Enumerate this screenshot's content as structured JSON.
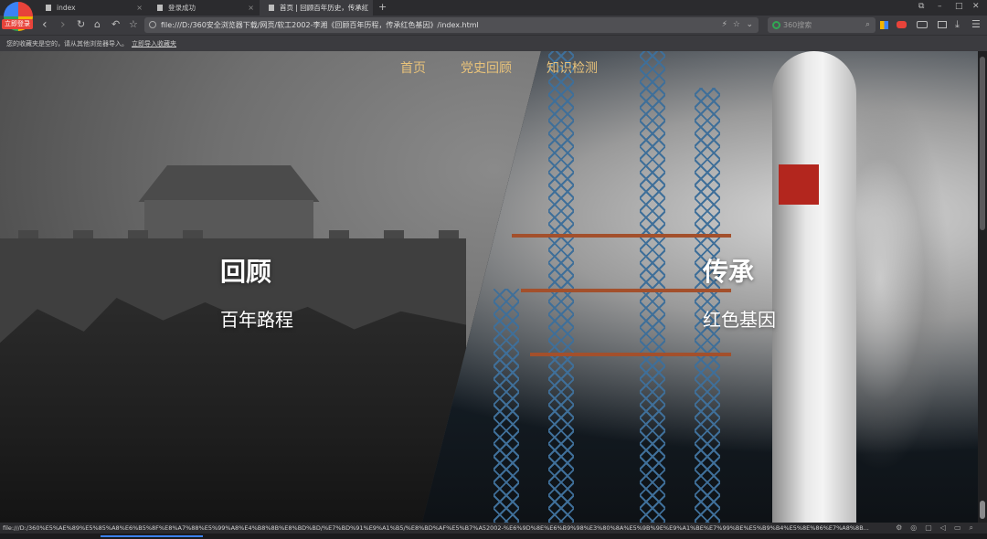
{
  "browser": {
    "logo_badge": "立即登录",
    "tabs": [
      {
        "title": "index",
        "close": "×"
      },
      {
        "title": "登录成功",
        "close": "×"
      },
      {
        "title": "首页 | 回顾百年历史，传承红",
        "close": "×"
      }
    ],
    "new_tab": "+",
    "address": "file:///D:/360安全浏览器下载/网页/软工2002-李湘《回顾百年历程，传承红色基因》/index.html",
    "search_placeholder": "360搜索",
    "bookmark_text": "您的收藏夹是空的，请从其他浏览器导入。",
    "bookmark_link": "立即导入收藏夹",
    "status_url": "file:///D:/360%E5%AE%89%E5%85%A8%E6%B5%8F%E8%A7%88%E5%99%A8%E4%B8%8B%E8%BD%BD/%E7%BD%91%E9%A1%B5/%E8%BD%AF%E5%B7%A52002-%E6%9D%8E%E6%B9%98%E3%80%8A%E5%9B%9E%E9%A1%BE%E7%99%BE%E5%B9%B4%E5%8E%86%E7%A8%8B...",
    "icons": {
      "back": "‹",
      "forward": "›",
      "home": "⌂",
      "reload": "↻",
      "undo": "↶",
      "star": "☆",
      "lightning": "⚡",
      "fav": "☆",
      "dropdown": "⌄",
      "search_mag": "⌕",
      "minimize": "–",
      "maximize": "□",
      "close": "✕",
      "restore": "⧉",
      "menu": "☰",
      "download": "⤓"
    }
  },
  "page": {
    "nav": [
      {
        "label": "首页"
      },
      {
        "label": "党史回顾"
      },
      {
        "label": "知识检测"
      }
    ],
    "left": {
      "title": "回顾",
      "subtitle": "百年路程"
    },
    "right": {
      "title": "传承",
      "subtitle": "红色基因"
    },
    "colors": {
      "nav_text": "#e8c27a",
      "headline": "#ffffff",
      "flag": "#b3261e"
    }
  }
}
